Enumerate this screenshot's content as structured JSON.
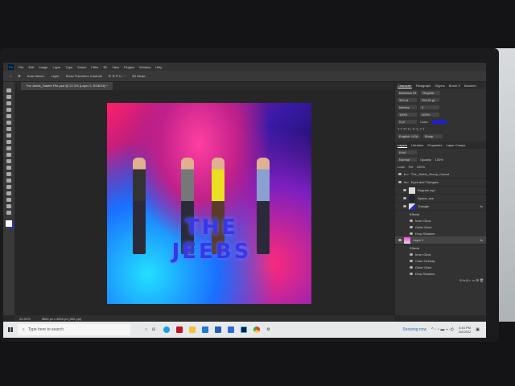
{
  "menu": [
    "File",
    "Edit",
    "Image",
    "Layer",
    "Type",
    "Select",
    "Filter",
    "3D",
    "View",
    "Plugins",
    "Window",
    "Help"
  ],
  "options": {
    "auto_select": "Auto-Select:",
    "layer": "Layer",
    "transform": "Show Transform Controls",
    "mode3d": "3D Mode:"
  },
  "document_tab": "The Jeebs_Starter File.psd @ 22.3% (Layer 2, RGB/16) *",
  "artwork_title": "THE JEEBS",
  "character_panel": {
    "tabs": [
      "Character",
      "Paragraph",
      "Glyphs",
      "Brush S",
      "Brushes"
    ],
    "font": "Bauhaus 93",
    "style": "Regular",
    "size": "300 pt",
    "leading": "115.61 pt",
    "kerning": "Metrics",
    "tracking": "0",
    "vscale": "100%",
    "hscale": "100%",
    "baseline": "0 pt",
    "color_label": "Color:",
    "language": "English: USA",
    "aa": "Sharp",
    "color": "#2020c8"
  },
  "layers_panel": {
    "tabs": [
      "Layers",
      "Libraries",
      "Properties",
      "Layer Comps"
    ],
    "filter": "Kind",
    "blend": "Normal",
    "opacity_label": "Opacity:",
    "opacity": "100%",
    "lock_label": "Lock:",
    "fill_label": "Fill:",
    "fill": "100%",
    "layers": [
      {
        "name": "The_Jeebs_Group_Cutout"
      },
      {
        "name": "Eyes and Triangles"
      },
      {
        "name": "Regular eye"
      },
      {
        "name": "Space_eye"
      },
      {
        "name": "Triangle",
        "effects_label": "Effects",
        "effects": [
          "Inner Glow",
          "Outer Glow",
          "Drop Shadow"
        ]
      },
      {
        "name": "Layer 2",
        "effects_label": "Effects",
        "effects": [
          "Inner Glow",
          "Color Overlay",
          "Outer Glow",
          "Drop Shadow"
        ]
      }
    ]
  },
  "status": {
    "zoom": "22.31%",
    "size": "3600 px x 3600 px (300 ppi)"
  },
  "taskbar": {
    "search": "Type here to search",
    "weather": "Snowing now",
    "time": "3:43 PM",
    "date": "2/2/2022"
  }
}
